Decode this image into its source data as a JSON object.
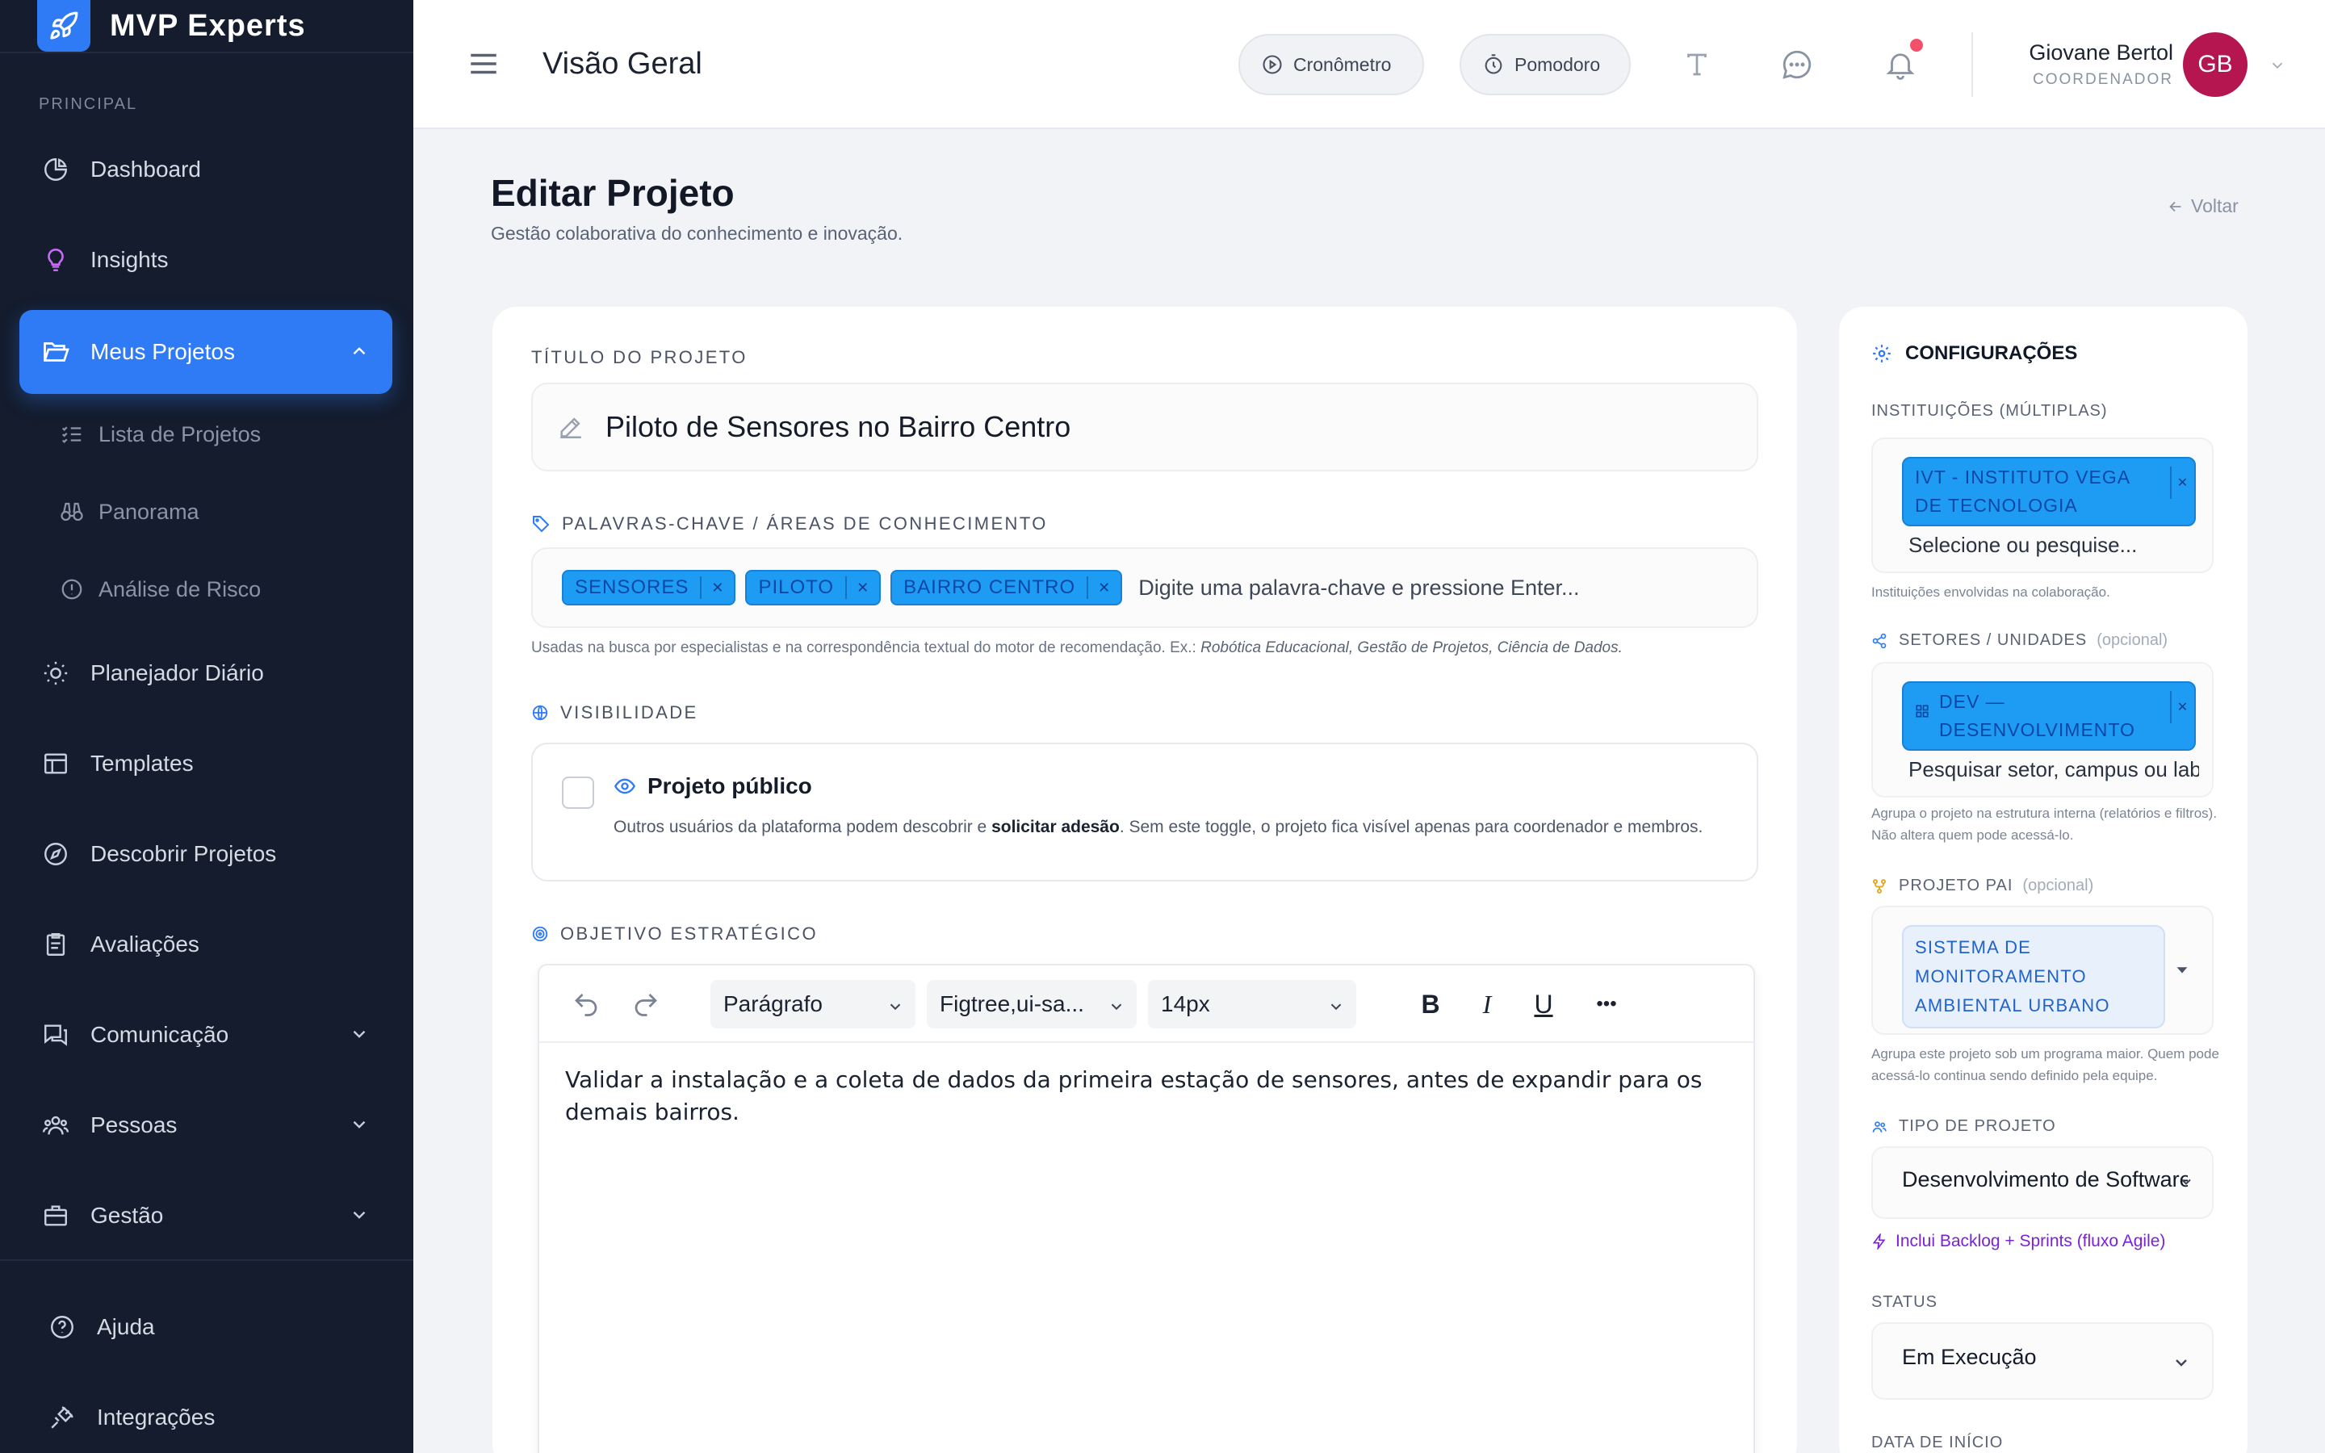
{
  "app": {
    "name": "MVP Experts",
    "accent": "#2f7bf6",
    "sidebar_bg": "#141c2d"
  },
  "sidebar": {
    "section_label": "PRINCIPAL",
    "items": [
      {
        "label": "Dashboard",
        "icon": "chart-pie-icon"
      },
      {
        "label": "Insights",
        "icon": "lightbulb-icon"
      },
      {
        "label": "Meus Projetos",
        "icon": "folder-open-icon",
        "active": true,
        "expanded": true
      },
      {
        "label": "Planejador Diário",
        "icon": "sun-icon"
      },
      {
        "label": "Templates",
        "icon": "layout-icon"
      },
      {
        "label": "Descobrir Projetos",
        "icon": "compass-icon"
      },
      {
        "label": "Avaliações",
        "icon": "clipboard-icon"
      },
      {
        "label": "Comunicação",
        "icon": "chat-icon",
        "collapsible": true
      },
      {
        "label": "Pessoas",
        "icon": "users-icon",
        "collapsible": true
      },
      {
        "label": "Gestão",
        "icon": "briefcase-icon",
        "collapsible": true
      }
    ],
    "sub_items": [
      {
        "label": "Lista de Projetos",
        "icon": "list-check-icon"
      },
      {
        "label": "Panorama",
        "icon": "binoculars-icon"
      },
      {
        "label": "Análise de Risco",
        "icon": "alert-circle-icon"
      }
    ],
    "footer_items": [
      {
        "label": "Ajuda",
        "icon": "help-circle-icon"
      },
      {
        "label": "Integrações",
        "icon": "plug-icon"
      }
    ]
  },
  "topbar": {
    "heading": "Visão Geral",
    "chronometer_label": "Cronômetro",
    "pomodoro_label": "Pomodoro",
    "user_name": "Giovane Bertol",
    "user_role": "COORDENADOR",
    "user_initials": "GB",
    "has_notification": true
  },
  "page": {
    "title": "Editar Projeto",
    "subtitle": "Gestão colaborativa do conhecimento e inovação.",
    "back_label": "Voltar"
  },
  "form": {
    "title_label": "TÍTULO DO PROJETO",
    "title_value": "Piloto de Sensores no Bairro Centro",
    "keywords_label": "PALAVRAS-CHAVE / ÁREAS DE CONHECIMENTO",
    "keywords": [
      "SENSORES",
      "PILOTO",
      "BAIRRO CENTRO"
    ],
    "keywords_placeholder": "Digite uma palavra-chave e pressione Enter...",
    "keywords_help_prefix": "Usadas na busca por especialistas e na correspondência textual do motor de recomendação. Ex.:",
    "keywords_help_examples": "Robótica Educacional, Gestão de Projetos, Ciência de Dados.",
    "visibility_label": "VISIBILIDADE",
    "public_title": "Projeto público",
    "public_checked": false,
    "public_desc_1": "Outros usuários da plataforma podem descobrir e ",
    "public_desc_bold": "solicitar adesão",
    "public_desc_2": ". Sem este toggle, o projeto fica visível apenas para coordenador e membros.",
    "objective_label": "OBJETIVO ESTRATÉGICO",
    "editor": {
      "block_style": "Parágrafo",
      "font_family": "Figtree,ui-sa...",
      "font_size": "14px",
      "bold": "B",
      "italic": "I",
      "underline": "U",
      "more": "•••",
      "content": "Validar a instalação e a coleta de dados da primeira estação de sensores, antes de expandir para os demais bairros."
    }
  },
  "config": {
    "title": "CONFIGURAÇÕES",
    "institutions_label": "INSTITUIÇÕES (MÚLTIPLAS)",
    "institutions": [
      "IVT - INSTITUTO VEGA DE TECNOLOGIA"
    ],
    "institutions_placeholder": "Selecione ou pesquise...",
    "institutions_help": "Instituições envolvidas na colaboração.",
    "sectors_label": "SETORES / UNIDADES",
    "optional": "(opcional)",
    "sectors": [
      "DEV — DESENVOLVIMENTO"
    ],
    "sectors_placeholder": "Pesquisar setor, campus ou lab",
    "sectors_help": "Agrupa o projeto na estrutura interna (relatórios e filtros). Não altera quem pode acessá-lo.",
    "parent_label": "PROJETO PAI",
    "parent_value": "SISTEMA DE MONITORAMENTO AMBIENTAL URBANO",
    "parent_help": "Agrupa este projeto sob um programa maior. Quem pode acessá-lo continua sendo definido pela equipe.",
    "type_label": "TIPO DE PROJETO",
    "type_value": "Desenvolvimento de Software",
    "type_note": "Inclui Backlog + Sprints (fluxo Agile)",
    "status_label": "STATUS",
    "status_value": "Em Execução",
    "start_label": "DATA DE INÍCIO"
  }
}
